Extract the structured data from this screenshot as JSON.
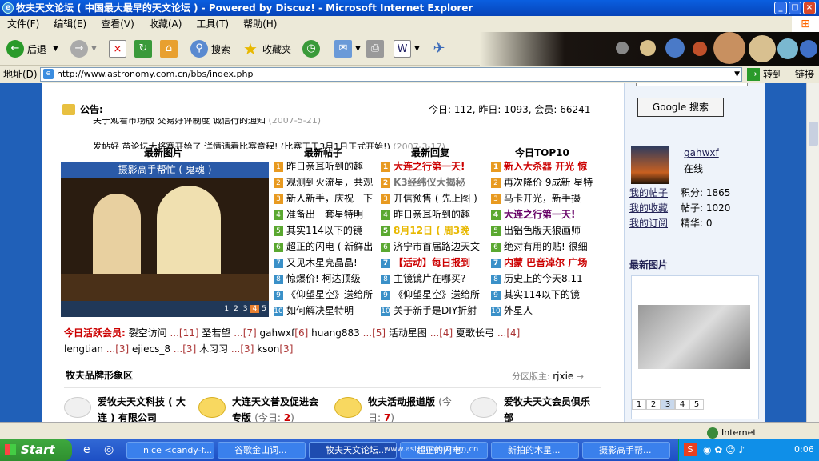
{
  "window": {
    "title": "牧夫天文论坛 ( 中国最大最早的天文论坛 ) - Powered by Discuz! - Microsoft Internet Explorer"
  },
  "menu": [
    "文件(F)",
    "编辑(E)",
    "查看(V)",
    "收藏(A)",
    "工具(T)",
    "帮助(H)"
  ],
  "toolbar": {
    "back": "后退",
    "search": "搜索",
    "favorites": "收藏夹",
    "goto": "转到",
    "links": "链接"
  },
  "address": {
    "label": "地址(D)",
    "url": "http://www.astronomy.com.cn/bbs/index.php"
  },
  "notice": {
    "label": "公告:",
    "stats": "今日: 112, 昨日: 1093, 会员: 66241",
    "line1": "关于观看市场版  交易好评制度  诚信行的通知",
    "line1_date": "(2007-5-21)",
    "line2": "发帖好  苗论坛大将赛开始了  详情请看比赛章程! (比赛于于3月1日正式开始!)",
    "line2_date": "(2007-3-17)"
  },
  "columns": {
    "images": "最新图片",
    "posts": "最新帖子",
    "replies": "最新回复",
    "top": "今日TOP10"
  },
  "image_caption": "摄影高手帮忙 ( 鬼魂 )",
  "image_pager": [
    "1",
    "2",
    "3",
    "4",
    "5"
  ],
  "posts": [
    "昨日亲耳听到的趣",
    "观测到火流星，共观",
    "新人新手，庆祝一下",
    "准备出一套星特明",
    "其实114以下的镜",
    "超正的闪电 ( 新鲜出",
    "又见木星亮晶晶!",
    "惊爆价! 柯达顶级",
    "《仰望星空》送给所",
    "如何解决星特明"
  ],
  "replies": [
    "大连之行第一天!",
    "K3经纬仪大揭秘",
    "开信预售 ( 先上图 )",
    "昨日亲耳听到的趣",
    "8月12日 ( 周3晚",
    "济宁市首届路边天文",
    "【活动】每日报到",
    "主镜镜片在哪买?",
    "《仰望星空》送给所",
    "关于新手是DIY折射"
  ],
  "top10": [
    "新入大杀器 开光 惊",
    "再次降价 9成新 星特",
    "马卡开光，新手摄",
    "大连之行第一天!",
    "出铝色版天狼画师",
    "绝对有用的贴! 很细",
    "内蒙 巴音淖尔 广场",
    "历史上的今天8.11",
    "其实114以下的镜",
    "外星人"
  ],
  "active": {
    "label": "今日活跃会员:",
    "members": [
      {
        "name": "裂空访问",
        "count": "11"
      },
      {
        "name": "圣若望",
        "count": "7"
      },
      {
        "name": "gahwxf",
        "count": "6"
      },
      {
        "name": "huang883",
        "count": "5"
      },
      {
        "name": "活动星图",
        "count": "4"
      },
      {
        "name": "夏歌长弓",
        "count": "4"
      },
      {
        "name": "lengtian",
        "count": "3"
      },
      {
        "name": "ejiecs_8",
        "count": "3"
      },
      {
        "name": "木习习",
        "count": "3"
      },
      {
        "name": "kson",
        "count": "3"
      }
    ]
  },
  "brand": {
    "title": "牧夫品牌形象区",
    "mod_label": "分区版主:",
    "mod": "rjxie"
  },
  "forums": [
    {
      "name1": "爱牧夫天文科技 ( 大",
      "name2": "连 ) 有限公司",
      "today": ""
    },
    {
      "name1": "大连天文普及促进会",
      "name2": "专版",
      "today_label": "(今日: ",
      "today": "2"
    },
    {
      "name1": "牧夫活动报道版",
      "name2": "(今",
      "today_label": "日: ",
      "today": "7"
    },
    {
      "name1": "爱牧夫天文会员俱乐",
      "name2": "部",
      "today": ""
    }
  ],
  "sidebar": {
    "google_btn": "Google 搜索",
    "user": "gahwxf",
    "status": "在线",
    "links": [
      "我的帖子",
      "我的收藏",
      "我的订阅"
    ],
    "points_label": "积分:",
    "points": "1865",
    "posts_label": "帖子:",
    "posts": "1020",
    "elite_label": "精华:",
    "elite": "0",
    "latest_images": "最新图片",
    "pager": [
      "1",
      "2",
      "3",
      "4",
      "5"
    ]
  },
  "statusbar": {
    "zone": "Internet"
  },
  "taskbar": {
    "start": "Start",
    "tasks": [
      "nice <candy-f...",
      "谷歌金山词...",
      "牧夫天文论坛...",
      "超正的闪电...",
      "新拍的木星...",
      "摄影高手帮..."
    ],
    "watermark": "www.astronomy.com.cn",
    "clock": "0:06"
  },
  "colors": {
    "page_bg": "#2060b8",
    "accent_red": "#cc0000",
    "title_bar": "#0a5fe0"
  }
}
